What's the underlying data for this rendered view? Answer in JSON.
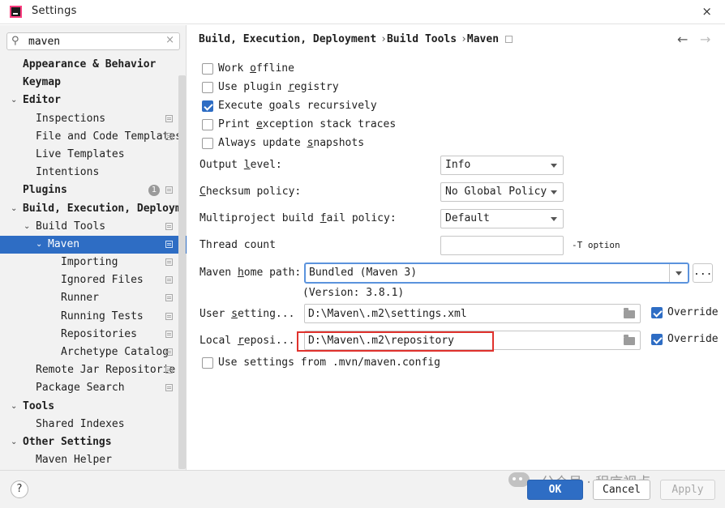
{
  "window": {
    "title": "Settings",
    "close_glyph": "×"
  },
  "search": {
    "value": "maven",
    "icon": "search-icon",
    "clear_glyph": "×"
  },
  "sidebar": {
    "items": [
      {
        "label": "Appearance & Behavior",
        "bold": true,
        "chevron": "",
        "has_page_icon": false
      },
      {
        "label": "Keymap",
        "bold": true,
        "chevron": "",
        "has_page_icon": false
      },
      {
        "label": "Editor",
        "bold": true,
        "chevron": "⌄",
        "has_page_icon": false
      },
      {
        "label": "Inspections",
        "bold": false,
        "chevron": "",
        "has_page_icon": true
      },
      {
        "label": "File and Code Templates",
        "bold": false,
        "chevron": "",
        "has_page_icon": true
      },
      {
        "label": "Live Templates",
        "bold": false,
        "chevron": "",
        "has_page_icon": false
      },
      {
        "label": "Intentions",
        "bold": false,
        "chevron": "",
        "has_page_icon": false
      },
      {
        "label": "Plugins",
        "bold": true,
        "chevron": "",
        "has_page_icon": true,
        "badge": "1"
      },
      {
        "label": "Build, Execution, Deploym",
        "bold": true,
        "chevron": "⌄",
        "has_page_icon": false
      },
      {
        "label": "Build Tools",
        "bold": false,
        "chevron": "⌄",
        "has_page_icon": true
      },
      {
        "label": "Maven",
        "bold": false,
        "chevron": "⌄",
        "has_page_icon": true,
        "selected": true
      },
      {
        "label": "Importing",
        "bold": false,
        "chevron": "",
        "has_page_icon": true
      },
      {
        "label": "Ignored Files",
        "bold": false,
        "chevron": "",
        "has_page_icon": true
      },
      {
        "label": "Runner",
        "bold": false,
        "chevron": "",
        "has_page_icon": true
      },
      {
        "label": "Running Tests",
        "bold": false,
        "chevron": "",
        "has_page_icon": true
      },
      {
        "label": "Repositories",
        "bold": false,
        "chevron": "",
        "has_page_icon": true
      },
      {
        "label": "Archetype Catalog",
        "bold": false,
        "chevron": "",
        "has_page_icon": true
      },
      {
        "label": "Remote Jar Repositorie",
        "bold": false,
        "chevron": "",
        "has_page_icon": true
      },
      {
        "label": "Package Search",
        "bold": false,
        "chevron": "",
        "has_page_icon": true
      },
      {
        "label": "Tools",
        "bold": true,
        "chevron": "⌄",
        "has_page_icon": false
      },
      {
        "label": "Shared Indexes",
        "bold": false,
        "chevron": "",
        "has_page_icon": false
      },
      {
        "label": "Other Settings",
        "bold": true,
        "chevron": "⌄",
        "has_page_icon": false
      },
      {
        "label": "Maven Helper",
        "bold": false,
        "chevron": "",
        "has_page_icon": false
      }
    ]
  },
  "breadcrumb": {
    "parts": [
      "Build, Execution, Deployment",
      "Build Tools",
      "Maven"
    ],
    "separator": "›"
  },
  "nav": {
    "back_glyph": "←",
    "forward_glyph": "→"
  },
  "checkboxes": {
    "work_offline": {
      "pre": "Work ",
      "mn": "o",
      "post": "ffline",
      "checked": false
    },
    "use_plugin_registry": {
      "pre": "Use plugin ",
      "mn": "r",
      "post": "egistry",
      "checked": false
    },
    "execute_goals": {
      "pre": "Execute ",
      "mn": "g",
      "post": "oals recursively",
      "checked": true
    },
    "print_exception": {
      "pre": "Print ",
      "mn": "e",
      "post": "xception stack traces",
      "checked": false
    },
    "always_update": {
      "pre": "Always update ",
      "mn": "s",
      "post": "napshots",
      "checked": false
    },
    "use_mvn_config": {
      "pre": "Use settings from .mvn/maven.config",
      "mn": "",
      "post": "",
      "checked": false
    }
  },
  "fields": {
    "output_level": {
      "pre": "Output ",
      "mn": "l",
      "post": "evel:",
      "value": "Info"
    },
    "checksum_policy": {
      "pre": "",
      "mn": "C",
      "post": "hecksum policy:",
      "value": "No Global Policy"
    },
    "multiproject_fail": {
      "pre": "Multiproject build ",
      "mn": "f",
      "post": "ail policy:",
      "value": "Default"
    },
    "thread_count": {
      "label": "Thread count",
      "value": "",
      "hint": "-T option"
    },
    "maven_home": {
      "pre": "Maven ",
      "mn": "h",
      "post": "ome path:",
      "value": "Bundled (Maven 3)",
      "version": "(Version: 3.8.1)",
      "browse": "..."
    },
    "user_settings": {
      "pre": "User ",
      "mn": "s",
      "post": "etting...",
      "value": "D:\\Maven\\.m2\\settings.xml",
      "override_label": "Override",
      "override_checked": true
    },
    "local_repo": {
      "pre": "Local ",
      "mn": "r",
      "post": "eposi...",
      "value": "D:\\Maven\\.m2\\repository",
      "override_label": "Override",
      "override_checked": true
    }
  },
  "footer": {
    "help": "?",
    "ok": "OK",
    "cancel": "Cancel",
    "apply": "Apply",
    "watermark": "公众号 · 程序视点"
  },
  "colors": {
    "accent": "#2e6dc4",
    "highlight_box": "#e0322d",
    "focus_border": "#5b93dd"
  }
}
